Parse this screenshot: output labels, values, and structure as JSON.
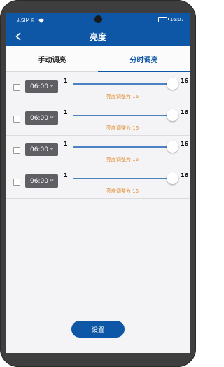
{
  "status_bar": {
    "carrier": "无SIM卡",
    "time": "16:07"
  },
  "header": {
    "title": "亮度"
  },
  "tabs": [
    {
      "label": "手动调亮"
    },
    {
      "label": "分时调亮"
    }
  ],
  "rows": [
    {
      "time": "06:00",
      "min": "1",
      "max": "16",
      "status": "亮度调整为 16",
      "level": 16
    },
    {
      "time": "06:00",
      "min": "1",
      "max": "16",
      "status": "亮度调整为 16",
      "level": 16
    },
    {
      "time": "06:00",
      "min": "1",
      "max": "16",
      "status": "亮度调整为 16",
      "level": 16
    },
    {
      "time": "06:00",
      "min": "1",
      "max": "16",
      "status": "亮度调整为 16",
      "level": 16
    }
  ],
  "footer": {
    "save_label": "设置"
  },
  "colors": {
    "primary": "#0d57a6",
    "status_text": "#e28a2b",
    "selector_bg": "#5f5f63"
  }
}
